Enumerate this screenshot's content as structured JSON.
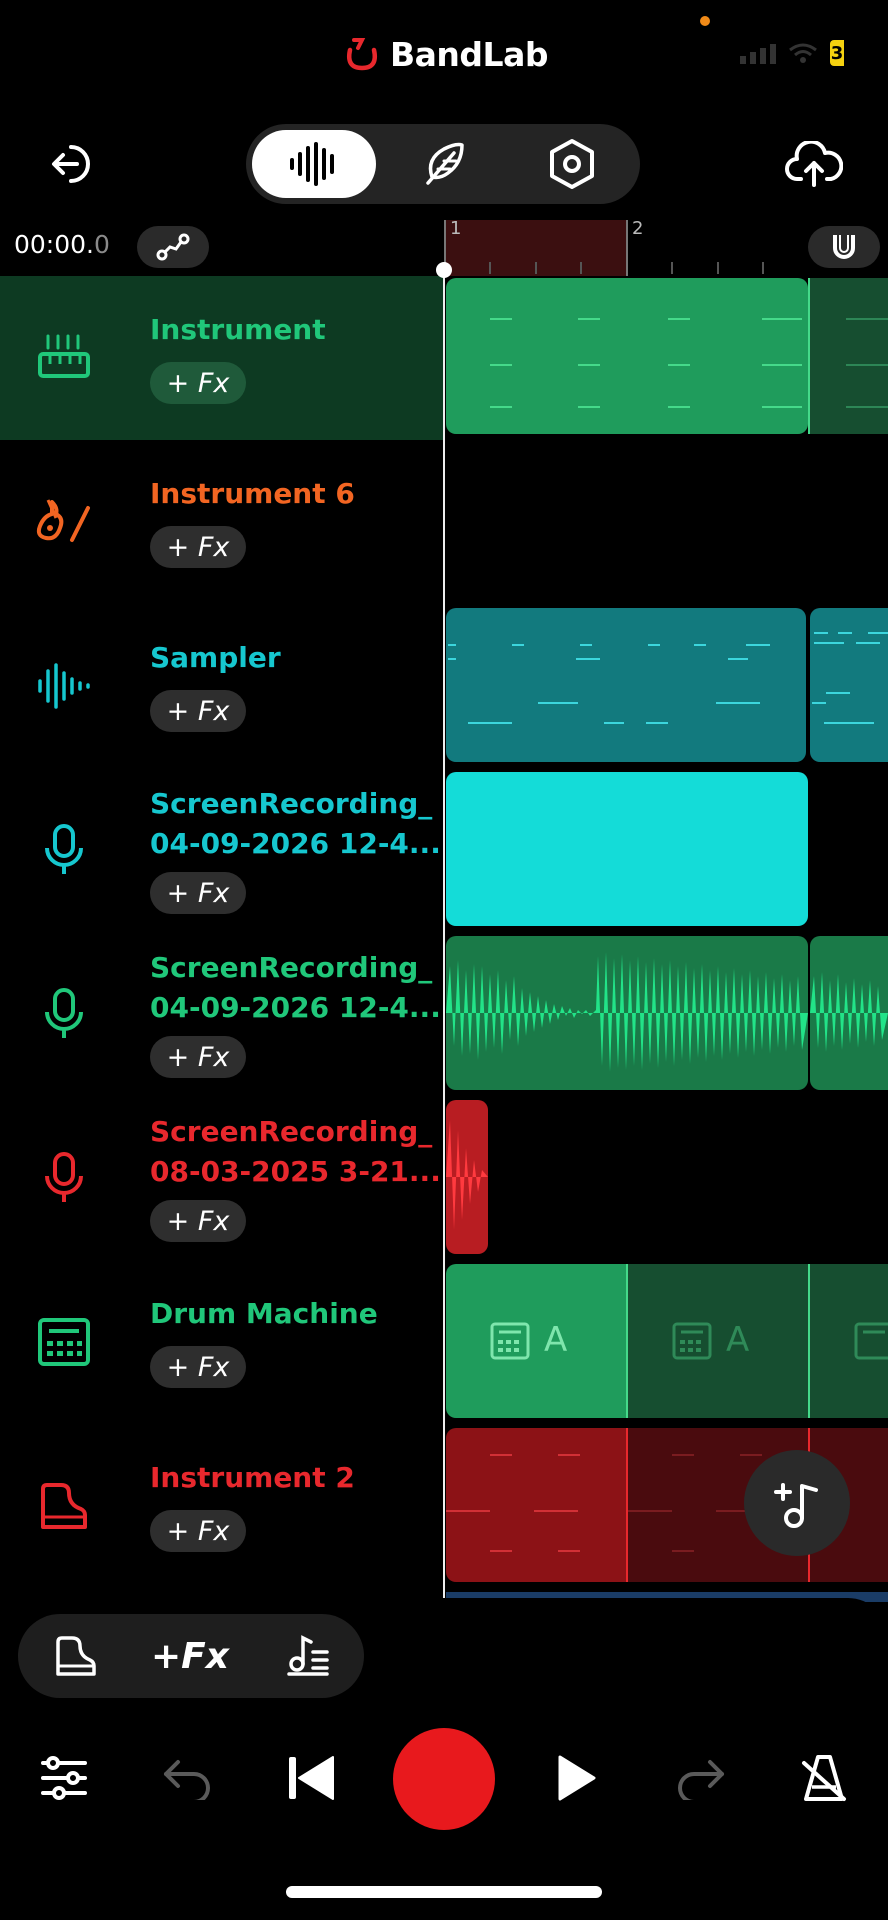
{
  "app": {
    "brand": "BandLab"
  },
  "status_bar": {
    "battery_text": "3",
    "colors": {
      "battery": "#f5d110",
      "privacy_dot": "#f08a18"
    }
  },
  "header": {
    "exit_icon": "exit-icon",
    "modes": [
      {
        "name": "waveform-mode",
        "icon": "waveform-icon",
        "active": true
      },
      {
        "name": "lyrics-mode",
        "icon": "feather-icon",
        "active": false
      },
      {
        "name": "settings-mode",
        "icon": "hexagon-settings-icon",
        "active": false
      }
    ],
    "upload_icon": "cloud-upload-icon"
  },
  "timeline": {
    "time_main": "00:00.",
    "time_ms": "0",
    "bar_numbers": [
      "1",
      "2"
    ]
  },
  "tracks": [
    {
      "name": "Instrument",
      "color": "#20c77a",
      "icon": "keyboard-icon",
      "fx": "+ Fx",
      "selected": true
    },
    {
      "name": "Instrument 6",
      "color": "#f26522",
      "icon": "guitar-icon",
      "fx": "+ Fx",
      "selected": false
    },
    {
      "name": "Sampler",
      "color": "#16c7cf",
      "icon": "sampler-wave-icon",
      "fx": "+ Fx",
      "selected": false
    },
    {
      "name": "ScreenRecording_\n04-09-2026 12-4...",
      "color": "#16c7cf",
      "icon": "microphone-icon",
      "fx": "+ Fx",
      "selected": false
    },
    {
      "name": "ScreenRecording_\n04-09-2026 12-4...",
      "color": "#20c77a",
      "icon": "microphone-icon",
      "fx": "+ Fx",
      "selected": false
    },
    {
      "name": "ScreenRecording_\n08-03-2025 3-21...",
      "color": "#e8282d",
      "icon": "microphone-icon",
      "fx": "+ Fx",
      "selected": false
    },
    {
      "name": "Drum Machine",
      "color": "#20c77a",
      "icon": "drum-machine-icon",
      "fx": "+ Fx",
      "selected": false
    },
    {
      "name": "Instrument 2",
      "color": "#e8282d",
      "icon": "piano-icon",
      "fx": "+ Fx",
      "selected": false
    }
  ],
  "drum_clip_label": "A",
  "bottom_tools": {
    "fx_label": "+Fx"
  },
  "transport": {
    "mixer_icon": "mixer-sliders-icon",
    "undo_icon": "undo-icon",
    "rewind_icon": "skip-back-icon",
    "record_icon": "record-icon",
    "play_icon": "play-icon",
    "redo_icon": "redo-icon",
    "metronome_icon": "metronome-icon"
  }
}
